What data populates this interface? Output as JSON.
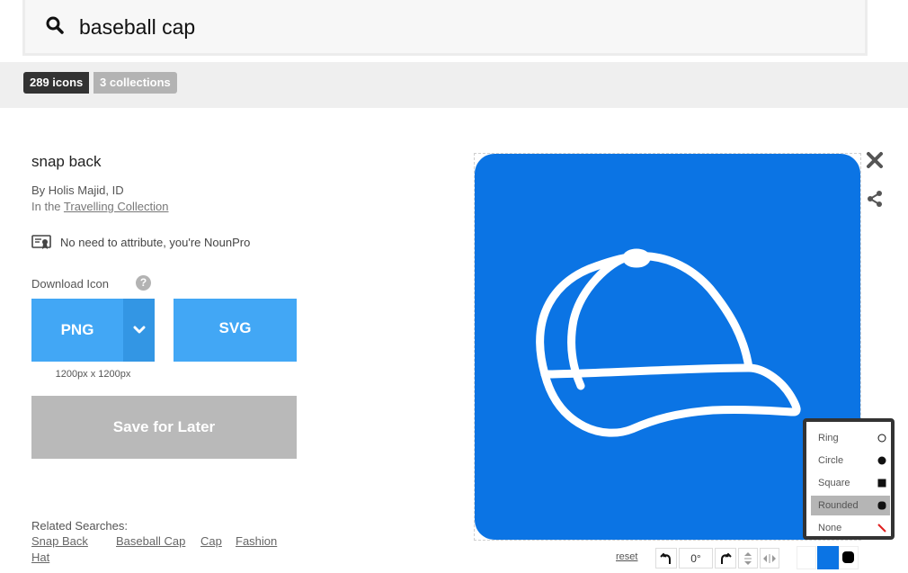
{
  "search": {
    "query": "baseball cap"
  },
  "results": {
    "icons_count": "289 icons",
    "collections_count": "3 collections"
  },
  "icon": {
    "title": "snap back",
    "author": "By Holis Majid, ID",
    "collection_prefix": "In the ",
    "collection_link": "Travelling Collection",
    "attribution": "No need to attribute, you're NounPro"
  },
  "download": {
    "label": "Download Icon",
    "help": "?",
    "png_label": "PNG",
    "svg_label": "SVG",
    "png_size": "1200px x 1200px",
    "save_label": "Save for Later"
  },
  "related": {
    "label": "Related Searches:",
    "links": [
      "Snap Back",
      "Baseball Cap",
      "Cap",
      "Fashion",
      "Hat"
    ]
  },
  "preview": {
    "background_color": "#0b74e4",
    "icon_color": "#ffffff",
    "shape_options": [
      {
        "label": "Ring",
        "mark": "ring-icon"
      },
      {
        "label": "Circle",
        "mark": "circle-icon"
      },
      {
        "label": "Square",
        "mark": "square-icon"
      },
      {
        "label": "Rounded",
        "mark": "rounded-icon"
      },
      {
        "label": "None",
        "mark": "none-icon"
      }
    ],
    "selected_shape": "Rounded",
    "reset_label": "reset",
    "rotation": "0°",
    "swatches": [
      "#ffffff",
      "#0b74e4",
      "#000000"
    ]
  },
  "colors": {
    "accent": "#42a7f5",
    "accent_dark": "#3396e4",
    "disabled": "#b9b9b9",
    "pill_dark": "#333333",
    "pill_light": "#b3b3b3"
  }
}
